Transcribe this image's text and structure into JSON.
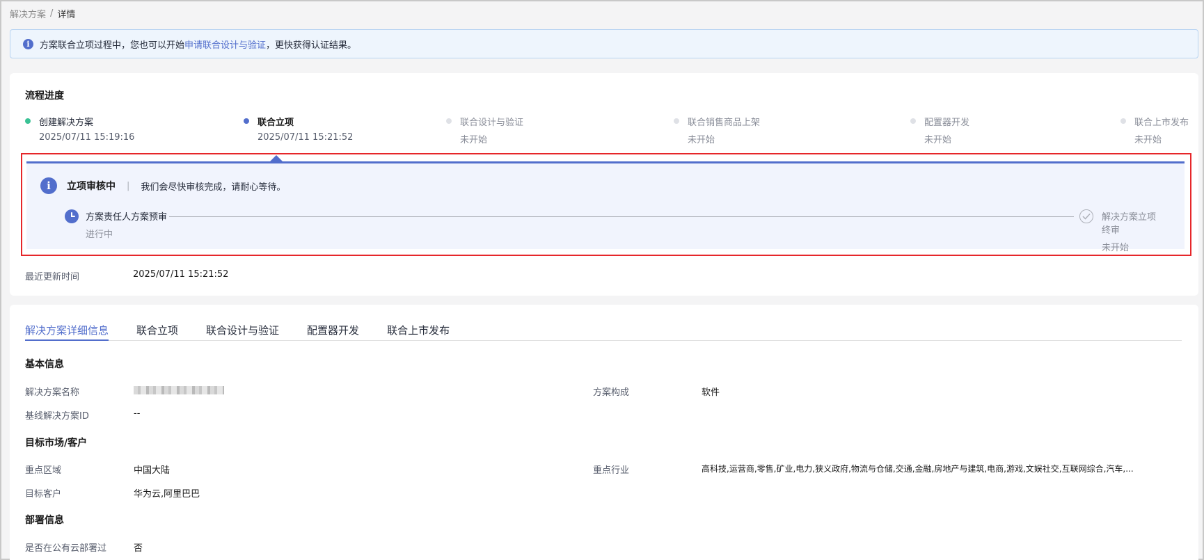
{
  "breadcrumb": {
    "parent": "解决方案",
    "separator": "/",
    "current": "详情"
  },
  "notice": {
    "prefix": "方案联合立项过程中，您也可以开始",
    "link": "申请联合设计与验证",
    "suffix": "，更快获得认证结果。"
  },
  "progress": {
    "title": "流程进度",
    "steps": [
      {
        "title": "创建解决方案",
        "time": "2025/07/11 15:19:16",
        "state": "done"
      },
      {
        "title": "联合立项",
        "time": "2025/07/11 15:21:52",
        "state": "active"
      },
      {
        "title": "联合设计与验证",
        "time": "未开始",
        "state": "todo"
      },
      {
        "title": "联合销售商品上架",
        "time": "未开始",
        "state": "todo"
      },
      {
        "title": "配置器开发",
        "time": "未开始",
        "state": "todo"
      },
      {
        "title": "联合上市发布",
        "time": "未开始",
        "state": "todo"
      }
    ]
  },
  "review": {
    "title": "立项审核中",
    "separator": "|",
    "desc": "我们会尽快审核完成，请耐心等待。",
    "sub_steps": [
      {
        "title": "方案责任人方案预审",
        "state": "进行中"
      },
      {
        "title": "解决方案立项终审",
        "state": "未开始"
      }
    ]
  },
  "last_update": {
    "label": "最近更新时间",
    "value": "2025/07/11 15:21:52"
  },
  "tabs": [
    "解决方案详细信息",
    "联合立项",
    "联合设计与验证",
    "配置器开发",
    "联合上市发布"
  ],
  "basic": {
    "title": "基本信息",
    "name_label": "解决方案名称",
    "composition_label": "方案构成",
    "composition_value": "软件",
    "baseline_label": "基线解决方案ID",
    "baseline_value": "--"
  },
  "market": {
    "title": "目标市场/客户",
    "region_label": "重点区域",
    "region_value": "中国大陆",
    "industry_label": "重点行业",
    "industry_value": "高科技,运营商,零售,矿业,电力,狭义政府,物流与仓储,交通,金融,房地产与建筑,电商,游戏,文娱社交,互联网综合,汽车,...",
    "customer_label": "目标客户",
    "customer_value": "华为云,阿里巴巴"
  },
  "deploy": {
    "title": "部署信息",
    "public_cloud_label": "是否在公有云部署过",
    "public_cloud_value": "否"
  }
}
